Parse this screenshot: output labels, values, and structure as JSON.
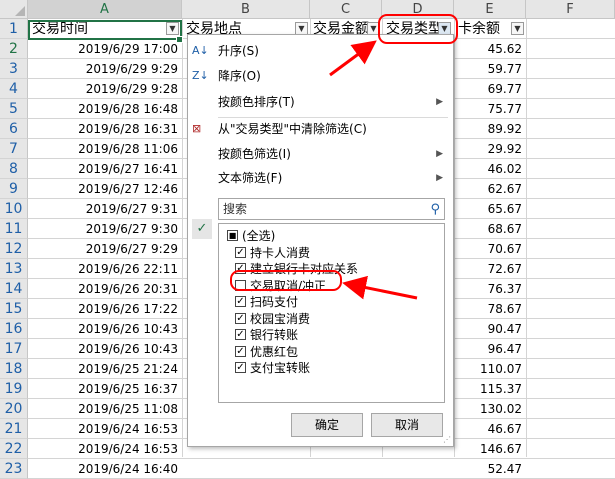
{
  "columns": [
    "A",
    "B",
    "C",
    "D",
    "E",
    "F"
  ],
  "rows": [
    "1",
    "2",
    "3",
    "4",
    "5",
    "6",
    "7",
    "8",
    "9",
    "10",
    "11",
    "12",
    "13",
    "14",
    "15",
    "16",
    "17",
    "18",
    "19",
    "20",
    "21",
    "22",
    "23"
  ],
  "headers": {
    "a": "交易时间",
    "b": "交易地点",
    "c": "交易金额",
    "d": "交易类型",
    "e": "卡余额"
  },
  "dates": [
    "2019/6/29 17:00",
    "2019/6/29 9:29",
    "2019/6/29 9:28",
    "2019/6/28 16:48",
    "2019/6/28 16:31",
    "2019/6/28 11:06",
    "2019/6/27 16:41",
    "2019/6/27 12:46",
    "2019/6/27 9:31",
    "2019/6/27 9:30",
    "2019/6/27 9:29",
    "2019/6/26 22:11",
    "2019/6/26 20:31",
    "2019/6/26 17:22",
    "2019/6/26 10:43",
    "2019/6/26 10:43",
    "2019/6/25 21:24",
    "2019/6/25 16:37",
    "2019/6/25 11:08",
    "2019/6/24 16:53",
    "2019/6/24 16:53",
    "2019/6/24 16:40"
  ],
  "balances": [
    "45.62",
    "59.77",
    "69.77",
    "75.77",
    "89.92",
    "29.92",
    "46.02",
    "62.67",
    "65.67",
    "68.67",
    "70.67",
    "72.67",
    "76.37",
    "78.67",
    "90.47",
    "96.47",
    "110.07",
    "115.37",
    "130.02",
    "46.67",
    "146.67",
    "52.47"
  ],
  "menu": {
    "sort_asc": "升序(S)",
    "sort_desc": "降序(O)",
    "sort_by_color": "按颜色排序(T)",
    "clear_filter": "从\"交易类型\"中清除筛选(C)",
    "filter_by_color": "按颜色筛选(I)",
    "text_filter": "文本筛选(F)",
    "search_placeholder": "搜索",
    "items": [
      {
        "label": "(全选)",
        "state": "partial"
      },
      {
        "label": "持卡人消费",
        "state": "checked"
      },
      {
        "label": "建立银行卡对应关系",
        "state": "checked"
      },
      {
        "label": "交易取消/冲正",
        "state": "unchecked"
      },
      {
        "label": "扫码支付",
        "state": "checked"
      },
      {
        "label": "校园宝消费",
        "state": "checked"
      },
      {
        "label": "银行转账",
        "state": "checked"
      },
      {
        "label": "优惠红包",
        "state": "checked"
      },
      {
        "label": "支付宝转账",
        "state": "checked"
      }
    ],
    "ok": "确定",
    "cancel": "取消"
  },
  "highlight_color": "#ff0000",
  "accent_color": "#217346"
}
